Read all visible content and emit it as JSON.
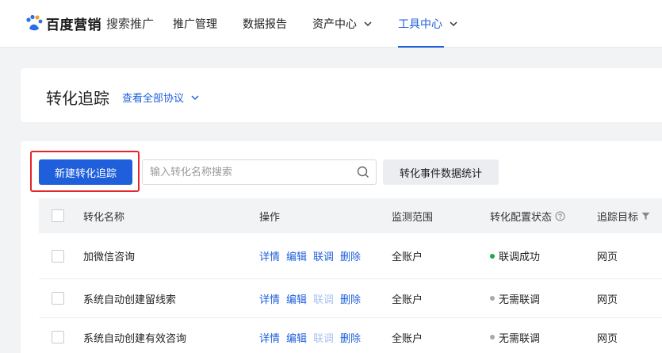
{
  "header": {
    "brand": "百度营销",
    "product": "搜索推广",
    "nav": [
      {
        "label": "推广管理",
        "dropdown": false,
        "active": false
      },
      {
        "label": "数据报告",
        "dropdown": false,
        "active": false
      },
      {
        "label": "资产中心",
        "dropdown": true,
        "active": false
      },
      {
        "label": "工具中心",
        "dropdown": true,
        "active": true
      }
    ]
  },
  "page": {
    "title": "转化追踪",
    "agreements_link": "查看全部协议"
  },
  "toolbar": {
    "new_label": "新建转化追踪",
    "search_placeholder": "输入转化名称搜索",
    "stats_label": "转化事件数据统计"
  },
  "table": {
    "columns": {
      "name": "转化名称",
      "ops": "操作",
      "scope": "监测范围",
      "status": "转化配置状态",
      "target": "追踪目标"
    },
    "rows": [
      {
        "name": "加微信咨询",
        "ops": [
          "详情",
          "编辑",
          "联调",
          "删除"
        ],
        "debug_enabled": true,
        "scope": "全账户",
        "status": "联调成功",
        "status_color": "#1aa84b",
        "target": "网页"
      },
      {
        "name": "系统自动创建留线索",
        "ops": [
          "详情",
          "编辑",
          "联调",
          "删除"
        ],
        "debug_enabled": false,
        "scope": "全账户",
        "status": "无需联调",
        "status_color": "#a5a9b0",
        "target": "网页"
      },
      {
        "name": "系统自动创建有效咨询",
        "ops": [
          "详情",
          "编辑",
          "联调",
          "删除"
        ],
        "debug_enabled": false,
        "scope": "全账户",
        "status": "无需联调",
        "status_color": "#a5a9b0",
        "target": "网页"
      }
    ]
  },
  "colors": {
    "accent": "#1f5fdb",
    "highlight": "#e5262b"
  }
}
